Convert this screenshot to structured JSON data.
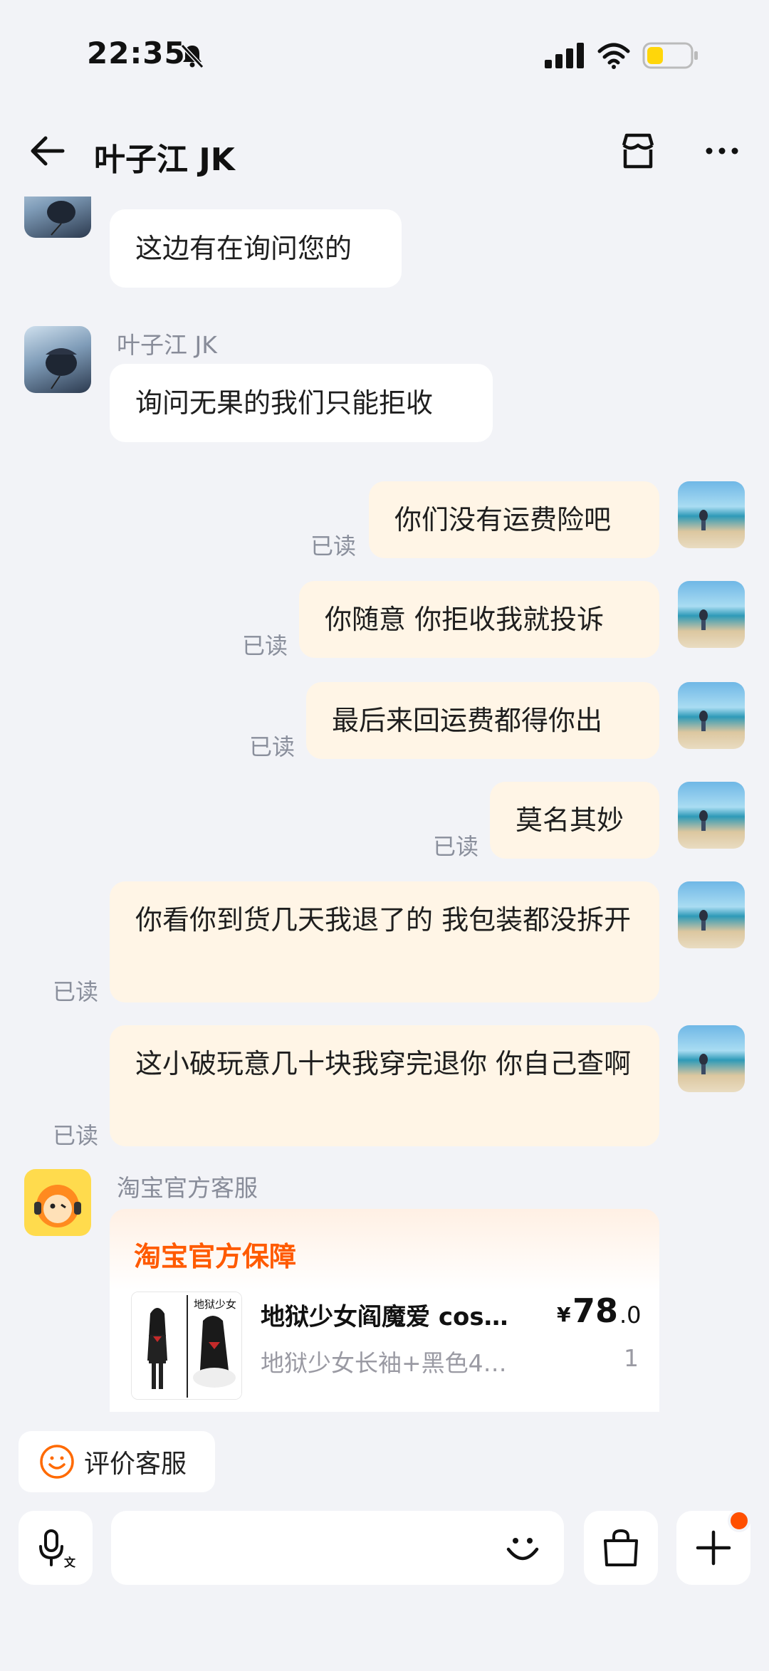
{
  "status_bar": {
    "time": "22:35"
  },
  "header": {
    "title": "叶子江 JK"
  },
  "messages": [
    {
      "sender": "",
      "text": "这边有在询问您的"
    },
    {
      "sender": "叶子江 JK",
      "text": "询问无果的我们只能拒收"
    },
    {
      "text": "你们没有运费险吧",
      "status": "已读"
    },
    {
      "text": "你随意 你拒收我就投诉",
      "status": "已读"
    },
    {
      "text": "最后来回运费都得你出",
      "status": "已读"
    },
    {
      "text": "莫名其妙",
      "status": "已读"
    },
    {
      "text": "你看你到货几天我退了的 我包装都没拆开",
      "status": "已读"
    },
    {
      "text": "这小破玩意几十块我穿完退你 你自己查啊",
      "status": "已读"
    }
  ],
  "service": {
    "sender": "淘宝官方客服",
    "card_title": "淘宝官方保障",
    "product": {
      "name": "地狱少女阎魔爱 cos…",
      "spec": "地狱少女长袖+黑色4…",
      "price_symbol": "¥",
      "price_int": "78",
      "price_dec": ".0",
      "quantity": "1",
      "image_caption": "地狱少女"
    }
  },
  "bottom": {
    "rate_label": "评价客服"
  }
}
